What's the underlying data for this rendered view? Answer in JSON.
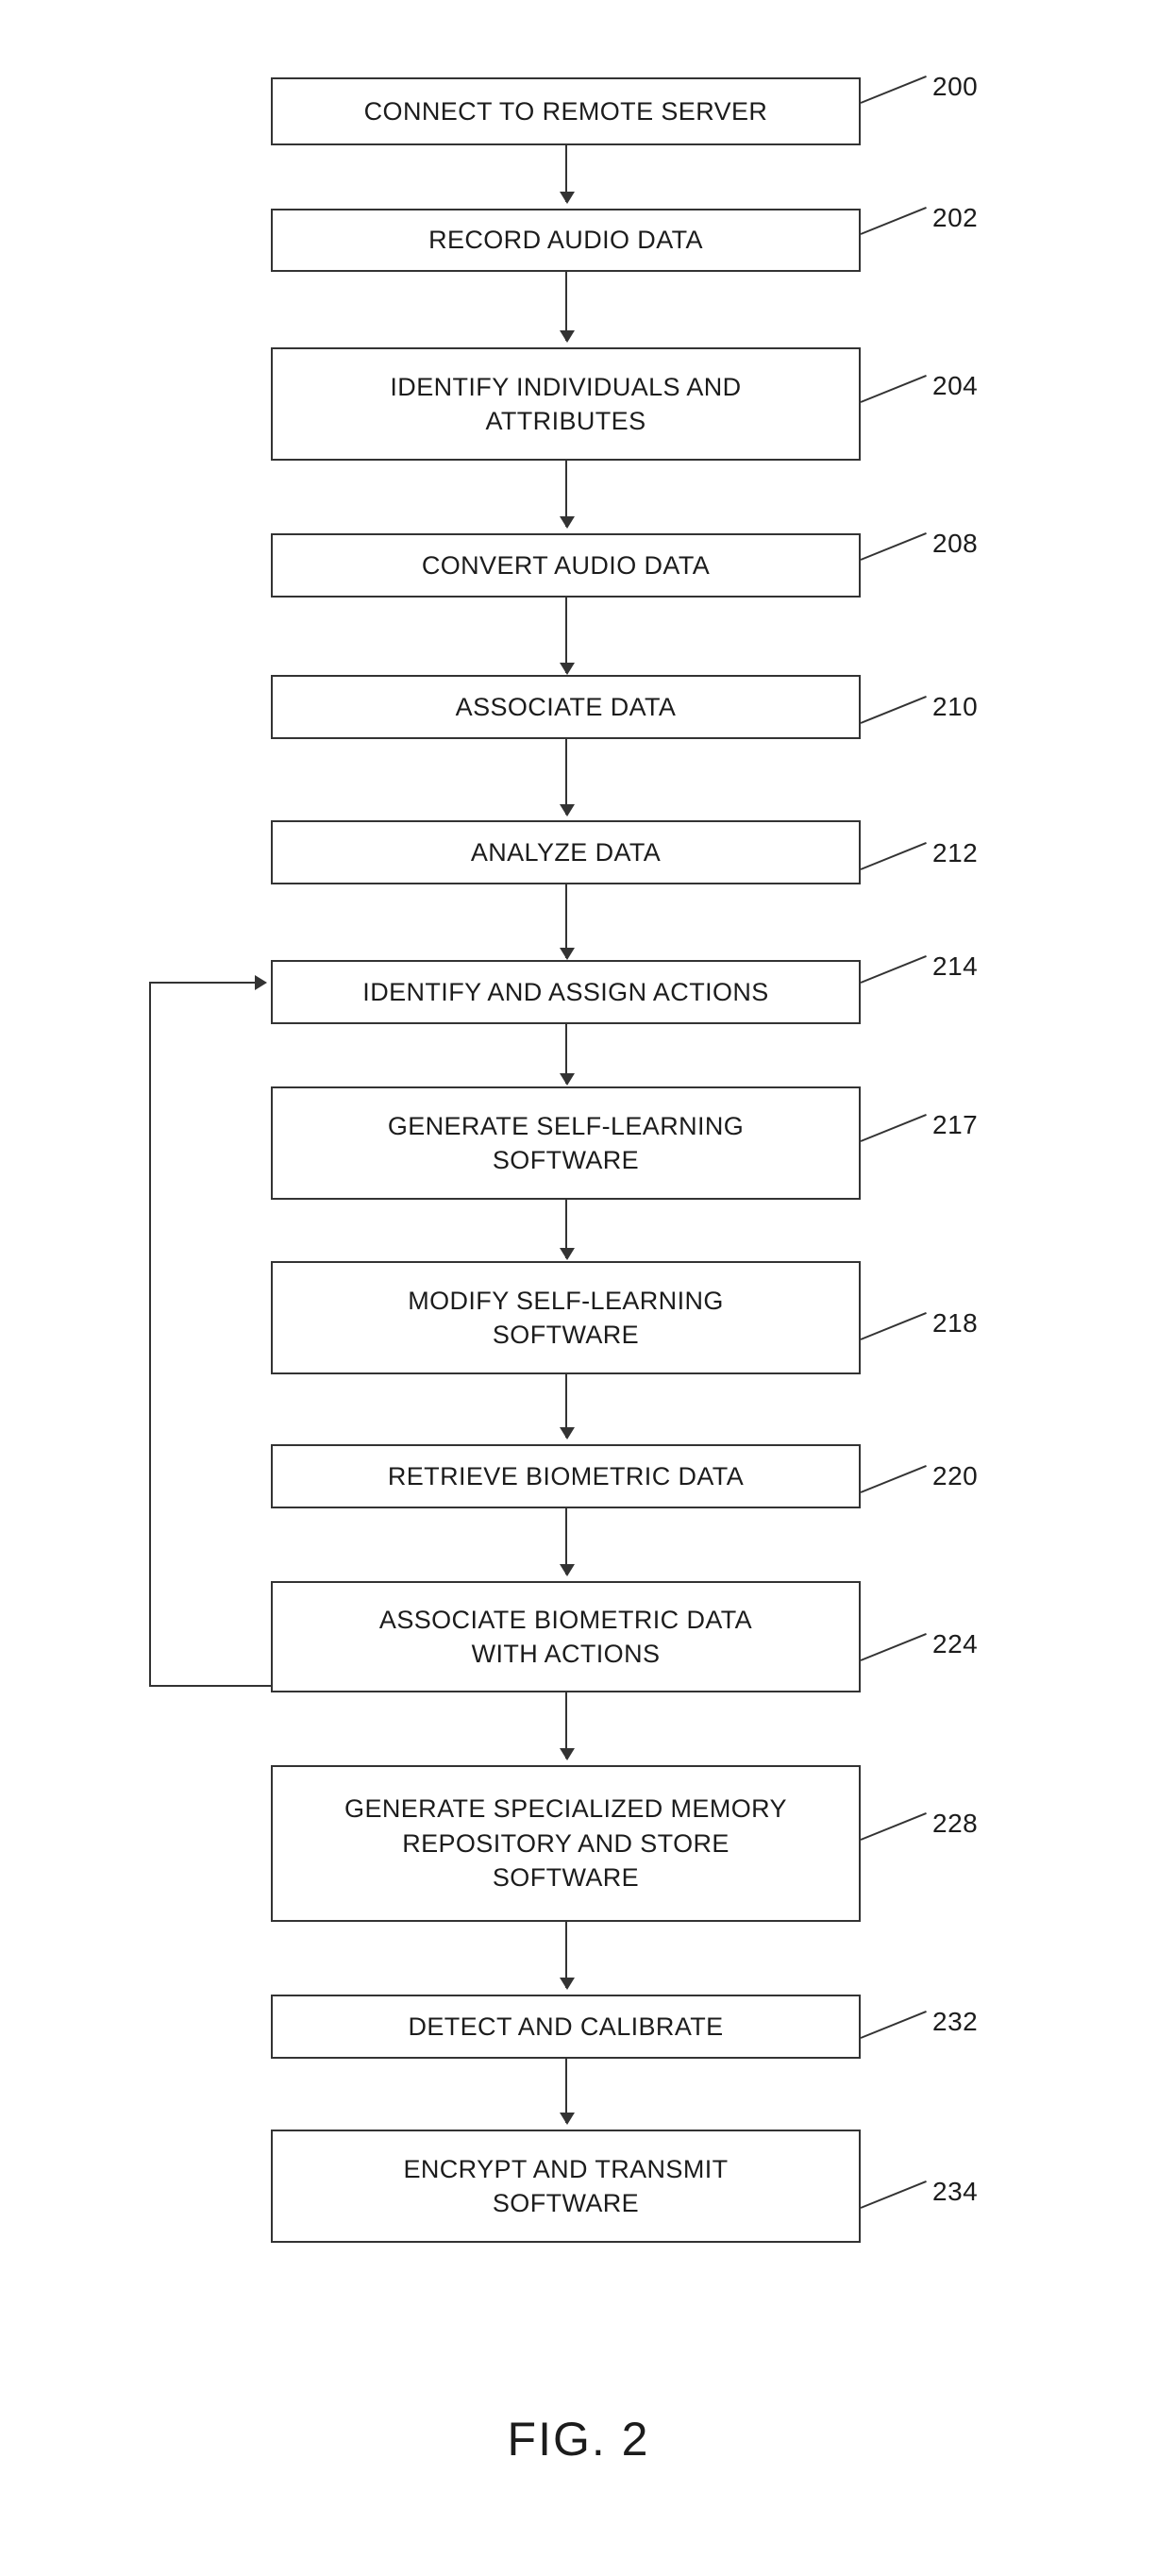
{
  "figure": {
    "caption": "FIG. 2",
    "nodes": [
      {
        "id": "200",
        "label": "CONNECT TO REMOTE SERVER",
        "ref": "200"
      },
      {
        "id": "202",
        "label": "RECORD AUDIO DATA",
        "ref": "202"
      },
      {
        "id": "204",
        "label": "IDENTIFY INDIVIDUALS AND\nATTRIBUTES",
        "ref": "204"
      },
      {
        "id": "208",
        "label": "CONVERT AUDIO DATA",
        "ref": "208"
      },
      {
        "id": "210",
        "label": "ASSOCIATE DATA",
        "ref": "210"
      },
      {
        "id": "212",
        "label": "ANALYZE DATA",
        "ref": "212"
      },
      {
        "id": "214",
        "label": "IDENTIFY AND ASSIGN ACTIONS",
        "ref": "214"
      },
      {
        "id": "217",
        "label": "GENERATE  SELF-LEARNING\nSOFTWARE",
        "ref": "217"
      },
      {
        "id": "218",
        "label": "MODIFY SELF-LEARNING\nSOFTWARE",
        "ref": "218"
      },
      {
        "id": "220",
        "label": "RETRIEVE BIOMETRIC DATA",
        "ref": "220"
      },
      {
        "id": "224",
        "label": "ASSOCIATE BIOMETRIC DATA\nWITH ACTIONS",
        "ref": "224"
      },
      {
        "id": "228",
        "label": "GENERATE SPECIALIZED MEMORY\nREPOSITORY AND STORE\nSOFTWARE",
        "ref": "228"
      },
      {
        "id": "232",
        "label": "DETECT AND CALIBRATE",
        "ref": "232"
      },
      {
        "id": "234",
        "label": "ENCRYPT AND TRANSMIT\nSOFTWARE",
        "ref": "234"
      }
    ],
    "colors": {
      "stroke": "#333333",
      "text": "#1c1c1c",
      "background": "#ffffff"
    }
  }
}
